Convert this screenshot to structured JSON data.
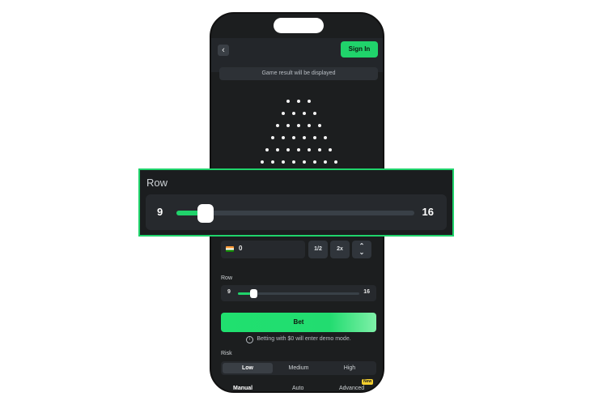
{
  "header": {
    "back_icon": "chevron-left-icon",
    "back_glyph": "‹",
    "signin_label": "Sign In"
  },
  "game": {
    "result_text": "Game result will be displayed",
    "peg_rows": [
      3,
      4,
      5,
      6,
      7,
      8
    ]
  },
  "bet": {
    "amount": "0",
    "half_label": "1/2",
    "double_label": "2x",
    "arrows_icon": "up-down-arrows-icon"
  },
  "row": {
    "label": "Row",
    "min": "9",
    "max": "16",
    "value_fraction": 0.0
  },
  "bet_button_label": "Bet",
  "demo_note": "Betting with $0 will enter demo mode.",
  "risk": {
    "label": "Risk",
    "options": [
      "Low",
      "Medium",
      "High"
    ],
    "selected": "Low"
  },
  "modes": {
    "manual": "Manual",
    "auto": "Auto",
    "advanced": "Advanced",
    "new_badge": "New"
  },
  "zoom": {
    "label": "Row",
    "min": "9",
    "max": "16",
    "value_fraction": 0.0
  },
  "colors": {
    "accent": "#20d36b",
    "background": "#1c1e1f",
    "panel": "#26292d"
  }
}
